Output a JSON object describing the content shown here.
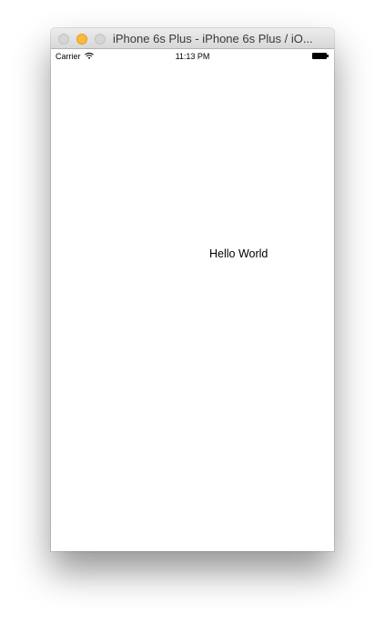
{
  "window": {
    "title": "iPhone 6s Plus - iPhone 6s Plus / iO...",
    "controls": {
      "close": {
        "color": "#d5d5d5"
      },
      "minimize": {
        "color": "#fcb93c"
      },
      "zoom": {
        "color": "#d5d5d5"
      }
    }
  },
  "status_bar": {
    "carrier": "Carrier",
    "wifi_icon": "wifi-icon",
    "time": "11:13 PM",
    "battery_icon": "battery-icon"
  },
  "content": {
    "label": "Hello World"
  }
}
